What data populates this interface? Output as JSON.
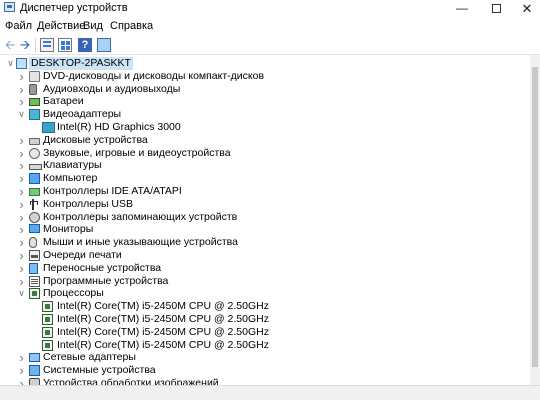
{
  "window": {
    "title": "Диспетчер устройств"
  },
  "menu": {
    "file": "Файл",
    "action": "Действие",
    "view": "Вид",
    "help": "Справка"
  },
  "toolbar": {
    "back": "back-arrow-icon",
    "forward": "forward-arrow-icon",
    "properties": "properties-icon",
    "help": "?",
    "show": "grid-icon",
    "monitor": "monitor-icon"
  },
  "colors": {
    "selected_bg": "#cce4f7",
    "accent": "#2a6ebd"
  },
  "tree": {
    "root": "DESKTOP-2PASKKT",
    "items": [
      {
        "label": "DVD-дисководы и дисководы компакт-дисков",
        "icon": "dvd-drive-icon"
      },
      {
        "label": "Аудиовходы и аудиовыходы",
        "icon": "audio-io-icon"
      },
      {
        "label": "Батареи",
        "icon": "battery-icon"
      },
      {
        "label": "Видеоадаптеры",
        "icon": "display-adapter-icon",
        "expanded": true,
        "children": [
          {
            "label": "Intel(R) HD Graphics 3000",
            "icon": "gpu-icon"
          }
        ]
      },
      {
        "label": "Дисковые устройства",
        "icon": "disk-drive-icon"
      },
      {
        "label": "Звуковые, игровые и видеоустройства",
        "icon": "sound-device-icon"
      },
      {
        "label": "Клавиатуры",
        "icon": "keyboard-icon"
      },
      {
        "label": "Компьютер",
        "icon": "computer-icon"
      },
      {
        "label": "Контроллеры IDE ATA/ATAPI",
        "icon": "ide-controller-icon"
      },
      {
        "label": "Контроллеры USB",
        "icon": "usb-icon"
      },
      {
        "label": "Контроллеры запоминающих устройств",
        "icon": "storage-controller-icon"
      },
      {
        "label": "Мониторы",
        "icon": "monitor-icon"
      },
      {
        "label": "Мыши и иные указывающие устройства",
        "icon": "mouse-icon"
      },
      {
        "label": "Очереди печати",
        "icon": "print-queue-icon"
      },
      {
        "label": "Переносные устройства",
        "icon": "portable-device-icon"
      },
      {
        "label": "Программные устройства",
        "icon": "software-device-icon"
      },
      {
        "label": "Процессоры",
        "icon": "processor-icon",
        "expanded": true,
        "children": [
          {
            "label": "Intel(R) Core(TM) i5-2450M CPU @ 2.50GHz",
            "icon": "cpu-icon"
          },
          {
            "label": "Intel(R) Core(TM) i5-2450M CPU @ 2.50GHz",
            "icon": "cpu-icon"
          },
          {
            "label": "Intel(R) Core(TM) i5-2450M CPU @ 2.50GHz",
            "icon": "cpu-icon"
          },
          {
            "label": "Intel(R) Core(TM) i5-2450M CPU @ 2.50GHz",
            "icon": "cpu-icon"
          }
        ]
      },
      {
        "label": "Сетевые адаптеры",
        "icon": "network-adapter-icon"
      },
      {
        "label": "Системные устройства",
        "icon": "system-device-icon"
      },
      {
        "label": "Устройства обработки изображений",
        "icon": "imaging-device-icon"
      }
    ]
  }
}
